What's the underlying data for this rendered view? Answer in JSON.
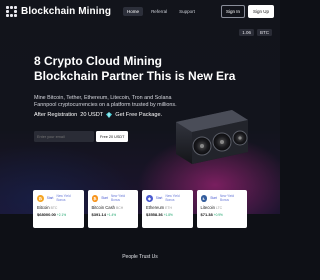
{
  "nav": {
    "brand": "Blockchain Mining",
    "links": [
      {
        "label": "Home"
      },
      {
        "label": "Referral"
      },
      {
        "label": "Support"
      }
    ],
    "signin_label": "Sign In",
    "signup_label": "Sign Up"
  },
  "ticker": {
    "left": "1.06",
    "right": "BTC"
  },
  "hero": {
    "headline_line1": "8 Crypto Cloud Mining",
    "headline_line2": "Blockchain Partner This is New Era",
    "sub_line1": "Mine Bitcoin, Tether, Ethereum, Litecoin, Tron and Solana",
    "sub_line2": "Fannpool cryptocurrencies on a platform trusted by millions.",
    "promo_prefix": "After Registration",
    "promo_amount": "20 USDT",
    "promo_suffix": "Get Free Package.",
    "email_placeholder": "Enter your email",
    "email_button": "Free 20 USDT"
  },
  "coins": [
    {
      "start": "Start",
      "tag": "New Yield Bonus",
      "name": "Bitcoin",
      "ticker": "BTC",
      "price": "$68000.00",
      "change": "+2.1%",
      "color": "#f5a524",
      "symbol": "₿"
    },
    {
      "start": "Start",
      "tag": "New Yield Bonus",
      "name": "Bitcoin Cash",
      "ticker": "BCH",
      "price": "$391.14",
      "change": "+1.4%",
      "color": "#f7931a",
      "symbol": "₿"
    },
    {
      "start": "Start",
      "tag": "New Yield Bonus",
      "name": "Ethereum",
      "ticker": "ETH",
      "price": "$3558.36",
      "change": "+1.8%",
      "color": "#4b5bd0",
      "symbol": "◆"
    },
    {
      "start": "Start",
      "tag": "New Yield Bonus",
      "name": "Litecoin",
      "ticker": "LTC",
      "price": "$71.38",
      "change": "+0.9%",
      "color": "#345d9d",
      "symbol": "Ł"
    }
  ],
  "footer": {
    "people_trust": "People Trust Us"
  }
}
